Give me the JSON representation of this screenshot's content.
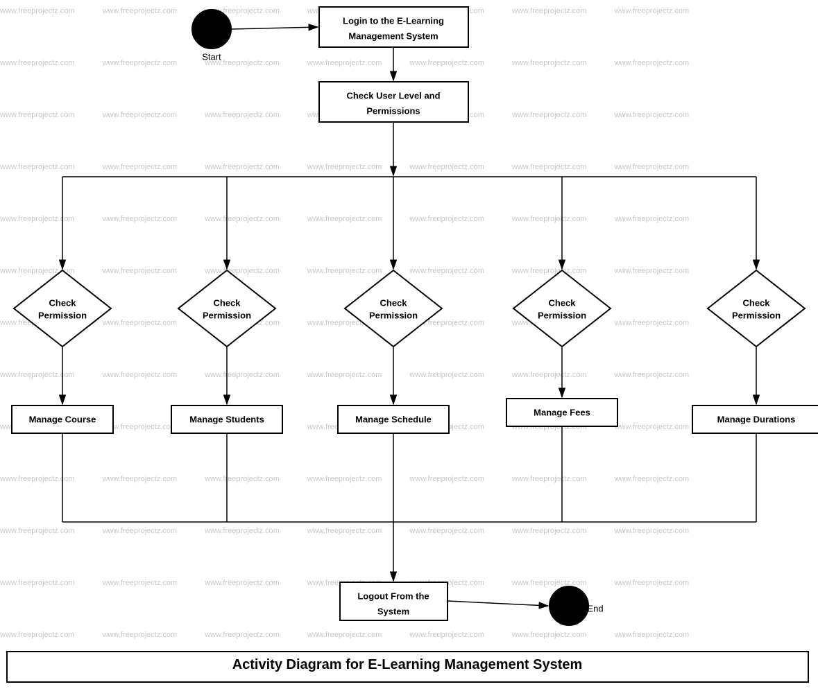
{
  "title": "Activity Diagram for E-Learning Management System",
  "watermark": "www.freeprojectz.com",
  "nodes": {
    "start_label": "Start",
    "end_label": "End",
    "login": "Login to the E-Learning\nManagement System",
    "check_user_level": "Check User Level and\nPermissions",
    "check_perm1": "Check\nPermission",
    "check_perm2": "Check\nPermission",
    "check_perm3": "Check\nPermission",
    "check_perm4": "Check\nPermission",
    "check_perm5": "Check\nPermission",
    "manage_course": "Manage Course",
    "manage_students": "Manage Students",
    "manage_schedule": "Manage Schedule",
    "manage_fees": "Manage Fees",
    "manage_durations": "Manage Durations",
    "logout": "Logout From the\nSystem",
    "caption": "Activity Diagram for E-Learning Management System"
  }
}
